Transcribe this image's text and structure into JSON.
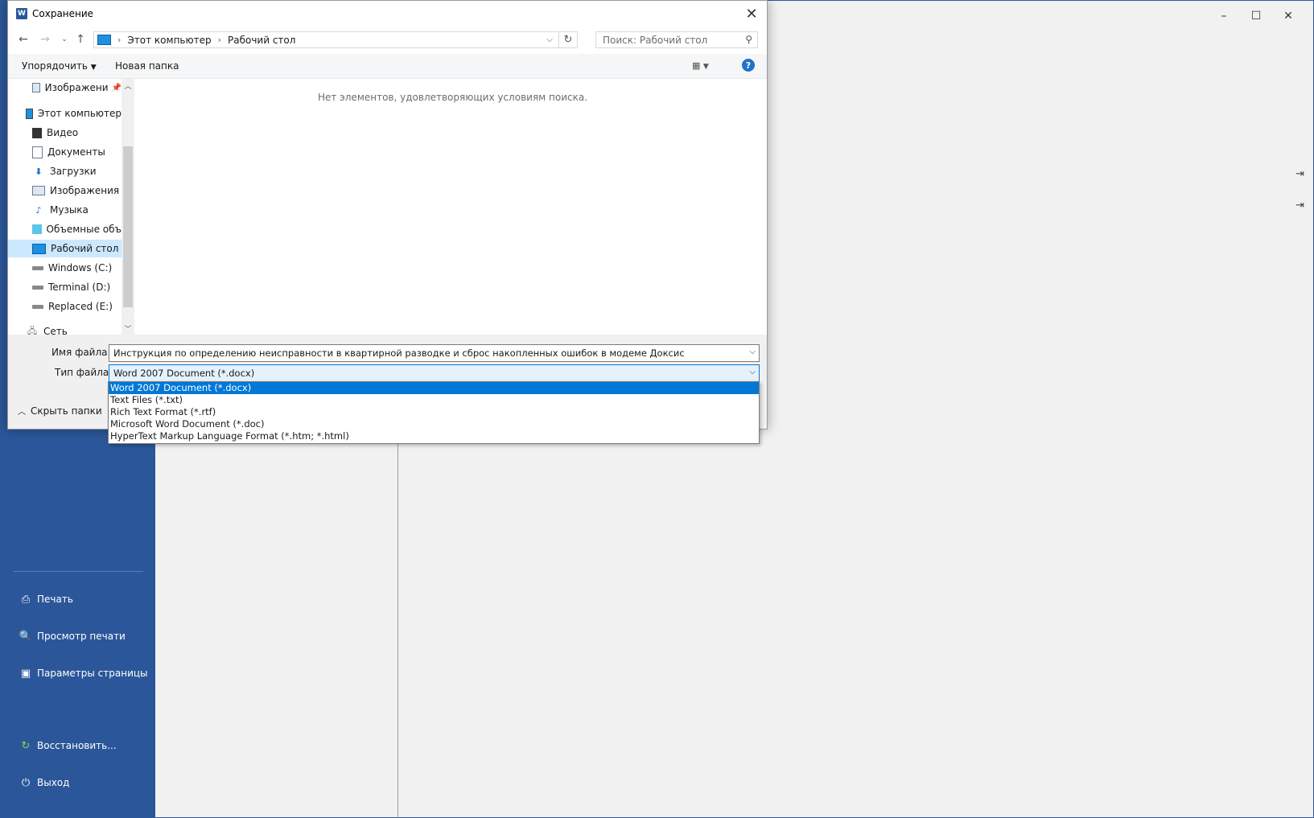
{
  "background_app": {
    "window_controls": [
      "–",
      "☐",
      "✕"
    ],
    "backstage_items": [
      {
        "label": "Печать",
        "icon": "printer-icon"
      },
      {
        "label": "Просмотр печати",
        "icon": "print-preview-icon"
      },
      {
        "label": "Параметры страницы",
        "icon": "page-setup-icon"
      },
      {
        "label": "Восстановить...",
        "icon": "restore-icon"
      },
      {
        "label": "Выход",
        "icon": "power-icon"
      }
    ],
    "accent_color": "#2b579a"
  },
  "dialog": {
    "title": "Сохранение",
    "address": {
      "crumbs": [
        "Этот компьютер",
        "Рабочий стол"
      ]
    },
    "search_placeholder": "Поиск: Рабочий стол",
    "toolbar": {
      "organize": "Упорядочить",
      "new_folder": "Новая папка",
      "help": "?"
    },
    "tree": [
      {
        "label": "Изображени",
        "icon": "pictures-icon",
        "pinned": true
      },
      {
        "label": "Этот компьютер",
        "icon": "computer-icon"
      },
      {
        "label": "Видео",
        "icon": "video-icon"
      },
      {
        "label": "Документы",
        "icon": "documents-icon"
      },
      {
        "label": "Загрузки",
        "icon": "downloads-icon"
      },
      {
        "label": "Изображения",
        "icon": "pictures-icon"
      },
      {
        "label": "Музыка",
        "icon": "music-icon"
      },
      {
        "label": "Объемные объ",
        "icon": "3d-objects-icon"
      },
      {
        "label": "Рабочий стол",
        "icon": "desktop-icon",
        "selected": true
      },
      {
        "label": "Windows (C:)",
        "icon": "drive-icon"
      },
      {
        "label": "Terminal (D:)",
        "icon": "drive-icon"
      },
      {
        "label": "Replaced (E:)",
        "icon": "drive-icon"
      },
      {
        "label": "Сеть",
        "icon": "network-icon"
      }
    ],
    "empty_message": "Нет элементов, удовлетворяющих условиям поиска.",
    "filename_label": "Имя файла:",
    "filename_value": "Инструкция по определению неисправности в квартирной разводке и сброс накопленных ошибок в модеме Доксис",
    "filetype_label": "Тип файла:",
    "filetype_value": "Word 2007 Document (*.docx)",
    "filetype_options": [
      "Word 2007 Document (*.docx)",
      "Text Files (*.txt)",
      "Rich Text Format (*.rtf)",
      "Microsoft Word Document (*.doc)",
      "HyperText Markup Language Format (*.htm; *.html)"
    ],
    "selected_option_index": 0,
    "hide_folders": "Скрыть папки"
  }
}
